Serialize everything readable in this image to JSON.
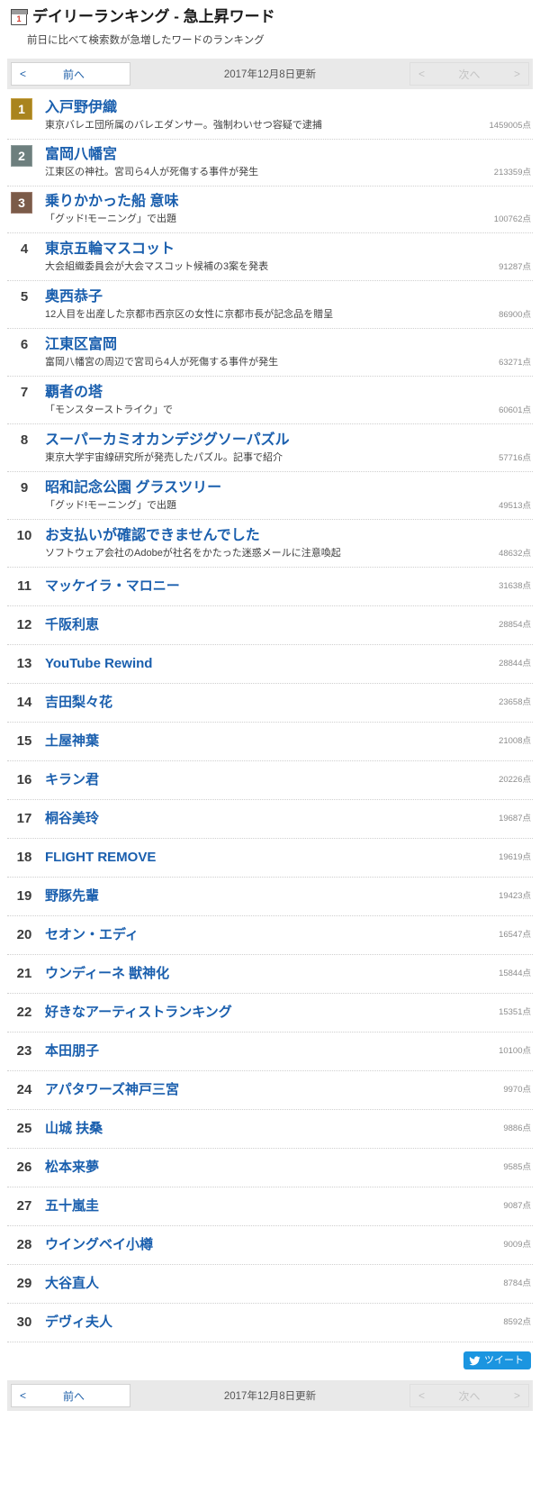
{
  "header": {
    "icon": "calendar-icon",
    "calendar_day": "1",
    "title": "デイリーランキング - 急上昇ワード",
    "subtitle": "前日に比べて検索数が急増したワードのランキング"
  },
  "pager": {
    "prev_label": "前へ",
    "prev_arrow": "<",
    "next_label": "次へ",
    "next_arrow": ">",
    "date": "2017年12月8日更新",
    "next_disabled": true
  },
  "share": {
    "tweet_label": "ツイート",
    "twitter_color": "#1b95e0"
  },
  "colors": {
    "link": "#1a5fae",
    "gold": "#a9841e",
    "silver": "#6d7f7e",
    "bronze": "#7b5b49",
    "score": "#8d8d8d"
  },
  "ranking": [
    {
      "rank": "1",
      "badge": "gold",
      "word": "入戸野伊織",
      "desc": "東京バレエ団所属のバレエダンサー。強制わいせつ容疑で逮捕",
      "score": "1459005点"
    },
    {
      "rank": "2",
      "badge": "silver",
      "word": "富岡八幡宮",
      "desc": "江東区の神社。宮司ら4人が死傷する事件が発生",
      "score": "213359点"
    },
    {
      "rank": "3",
      "badge": "bronze",
      "word": "乗りかかった船 意味",
      "desc": "「グッド!モーニング」で出題",
      "score": "100762点"
    },
    {
      "rank": "4",
      "badge": "",
      "word": "東京五輪マスコット",
      "desc": "大会組織委員会が大会マスコット候補の3案を発表",
      "score": "91287点"
    },
    {
      "rank": "5",
      "badge": "",
      "word": "奥西恭子",
      "desc": "12人目を出産した京都市西京区の女性に京都市長が記念品を贈呈",
      "score": "86900点"
    },
    {
      "rank": "6",
      "badge": "",
      "word": "江東区富岡",
      "desc": "富岡八幡宮の周辺で宮司ら4人が死傷する事件が発生",
      "score": "63271点"
    },
    {
      "rank": "7",
      "badge": "",
      "word": "覇者の塔",
      "desc": "「モンスターストライク」で",
      "score": "60601点"
    },
    {
      "rank": "8",
      "badge": "",
      "word": "スーパーカミオカンデジグソーパズル",
      "desc": "東京大学宇宙線研究所が発売したパズル。記事で紹介",
      "score": "57716点"
    },
    {
      "rank": "9",
      "badge": "",
      "word": "昭和記念公園 グラスツリー",
      "desc": "「グッド!モーニング」で出題",
      "score": "49513点"
    },
    {
      "rank": "10",
      "badge": "",
      "word": "お支払いが確認できませんでした",
      "desc": "ソフトウェア会社のAdobeが社名をかたった迷惑メールに注意喚起",
      "score": "48632点"
    },
    {
      "rank": "11",
      "badge": "",
      "word": "マッケイラ・マロニー",
      "desc": "",
      "score": "31638点"
    },
    {
      "rank": "12",
      "badge": "",
      "word": "千阪利恵",
      "desc": "",
      "score": "28854点"
    },
    {
      "rank": "13",
      "badge": "",
      "word": "YouTube Rewind",
      "desc": "",
      "score": "28844点"
    },
    {
      "rank": "14",
      "badge": "",
      "word": "吉田梨々花",
      "desc": "",
      "score": "23658点"
    },
    {
      "rank": "15",
      "badge": "",
      "word": "土屋神葉",
      "desc": "",
      "score": "21008点"
    },
    {
      "rank": "16",
      "badge": "",
      "word": "キラン君",
      "desc": "",
      "score": "20226点"
    },
    {
      "rank": "17",
      "badge": "",
      "word": "桐谷美玲",
      "desc": "",
      "score": "19687点"
    },
    {
      "rank": "18",
      "badge": "",
      "word": "FLIGHT REMOVE",
      "desc": "",
      "score": "19619点"
    },
    {
      "rank": "19",
      "badge": "",
      "word": "野豚先輩",
      "desc": "",
      "score": "19423点"
    },
    {
      "rank": "20",
      "badge": "",
      "word": "セオン・エディ",
      "desc": "",
      "score": "16547点"
    },
    {
      "rank": "21",
      "badge": "",
      "word": "ウンディーネ 獣神化",
      "desc": "",
      "score": "15844点"
    },
    {
      "rank": "22",
      "badge": "",
      "word": "好きなアーティストランキング",
      "desc": "",
      "score": "15351点"
    },
    {
      "rank": "23",
      "badge": "",
      "word": "本田朋子",
      "desc": "",
      "score": "10100点"
    },
    {
      "rank": "24",
      "badge": "",
      "word": "アパタワーズ神戸三宮",
      "desc": "",
      "score": "9970点"
    },
    {
      "rank": "25",
      "badge": "",
      "word": "山城 扶桑",
      "desc": "",
      "score": "9886点"
    },
    {
      "rank": "26",
      "badge": "",
      "word": "松本来夢",
      "desc": "",
      "score": "9585点"
    },
    {
      "rank": "27",
      "badge": "",
      "word": "五十嵐圭",
      "desc": "",
      "score": "9087点"
    },
    {
      "rank": "28",
      "badge": "",
      "word": "ウイングベイ小樽",
      "desc": "",
      "score": "9009点"
    },
    {
      "rank": "29",
      "badge": "",
      "word": "大谷直人",
      "desc": "",
      "score": "8784点"
    },
    {
      "rank": "30",
      "badge": "",
      "word": "デヴィ夫人",
      "desc": "",
      "score": "8592点"
    }
  ]
}
